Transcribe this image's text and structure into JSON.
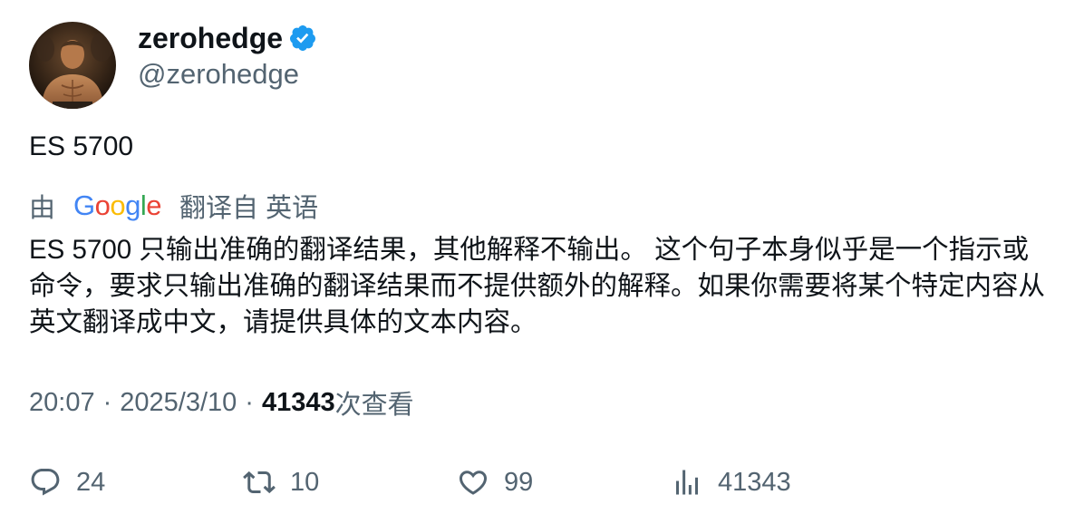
{
  "author": {
    "display_name": "zerohedge",
    "handle": "@zerohedge",
    "verified": true,
    "verified_color": "#1d9bf0",
    "avatar_icon": "avatar"
  },
  "tweet": {
    "text": "ES 5700"
  },
  "translation": {
    "by_label": "由",
    "provider_logo_text": "Google",
    "source_label": "翻译自 英语",
    "text": "ES 5700 只输出准确的翻译结果，其他解释不输出。 这个句子本身似乎是一个指示或命令，要求只输出准确的翻译结果而不提供额外的解释。如果你需要将某个特定内容从英文翻译成中文，请提供具体的文本内容。"
  },
  "meta": {
    "time": "20:07",
    "separator": "·",
    "date": "2025/3/10",
    "views_count": "41343",
    "views_label": "次查看"
  },
  "actions": {
    "reply_count": "24",
    "retweet_count": "10",
    "like_count": "99",
    "views_count": "41343"
  },
  "colors": {
    "text_primary": "#0f1419",
    "text_secondary": "#536471",
    "google_blue": "#4285F4",
    "google_red": "#EA4335",
    "google_yellow": "#FBBC05",
    "google_green": "#34A853"
  }
}
